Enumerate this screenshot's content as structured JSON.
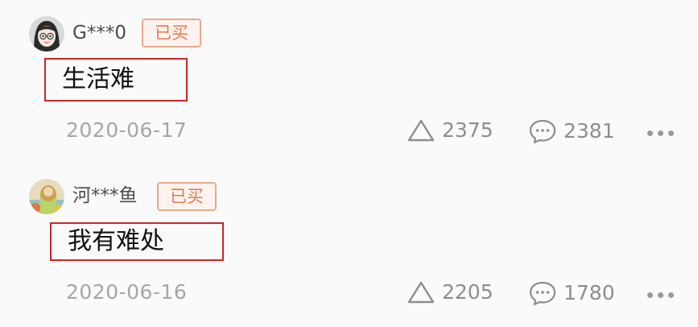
{
  "reviews": [
    {
      "username": "G***0",
      "badge": "已买",
      "comment": "生活难",
      "date": "2020-06-17",
      "likes": "2375",
      "replies": "2381",
      "avatar_icon": "girl-avatar-icon"
    },
    {
      "username": "河***鱼",
      "badge": "已买",
      "comment": "我有难处",
      "date": "2020-06-16",
      "likes": "2205",
      "replies": "1780",
      "avatar_icon": "illustrated-avatar-icon"
    }
  ],
  "colors": {
    "highlight_border": "#c9262a",
    "badge_text": "#e07a52",
    "badge_border": "#e9a98e",
    "meta_text": "#a6a6a6"
  }
}
